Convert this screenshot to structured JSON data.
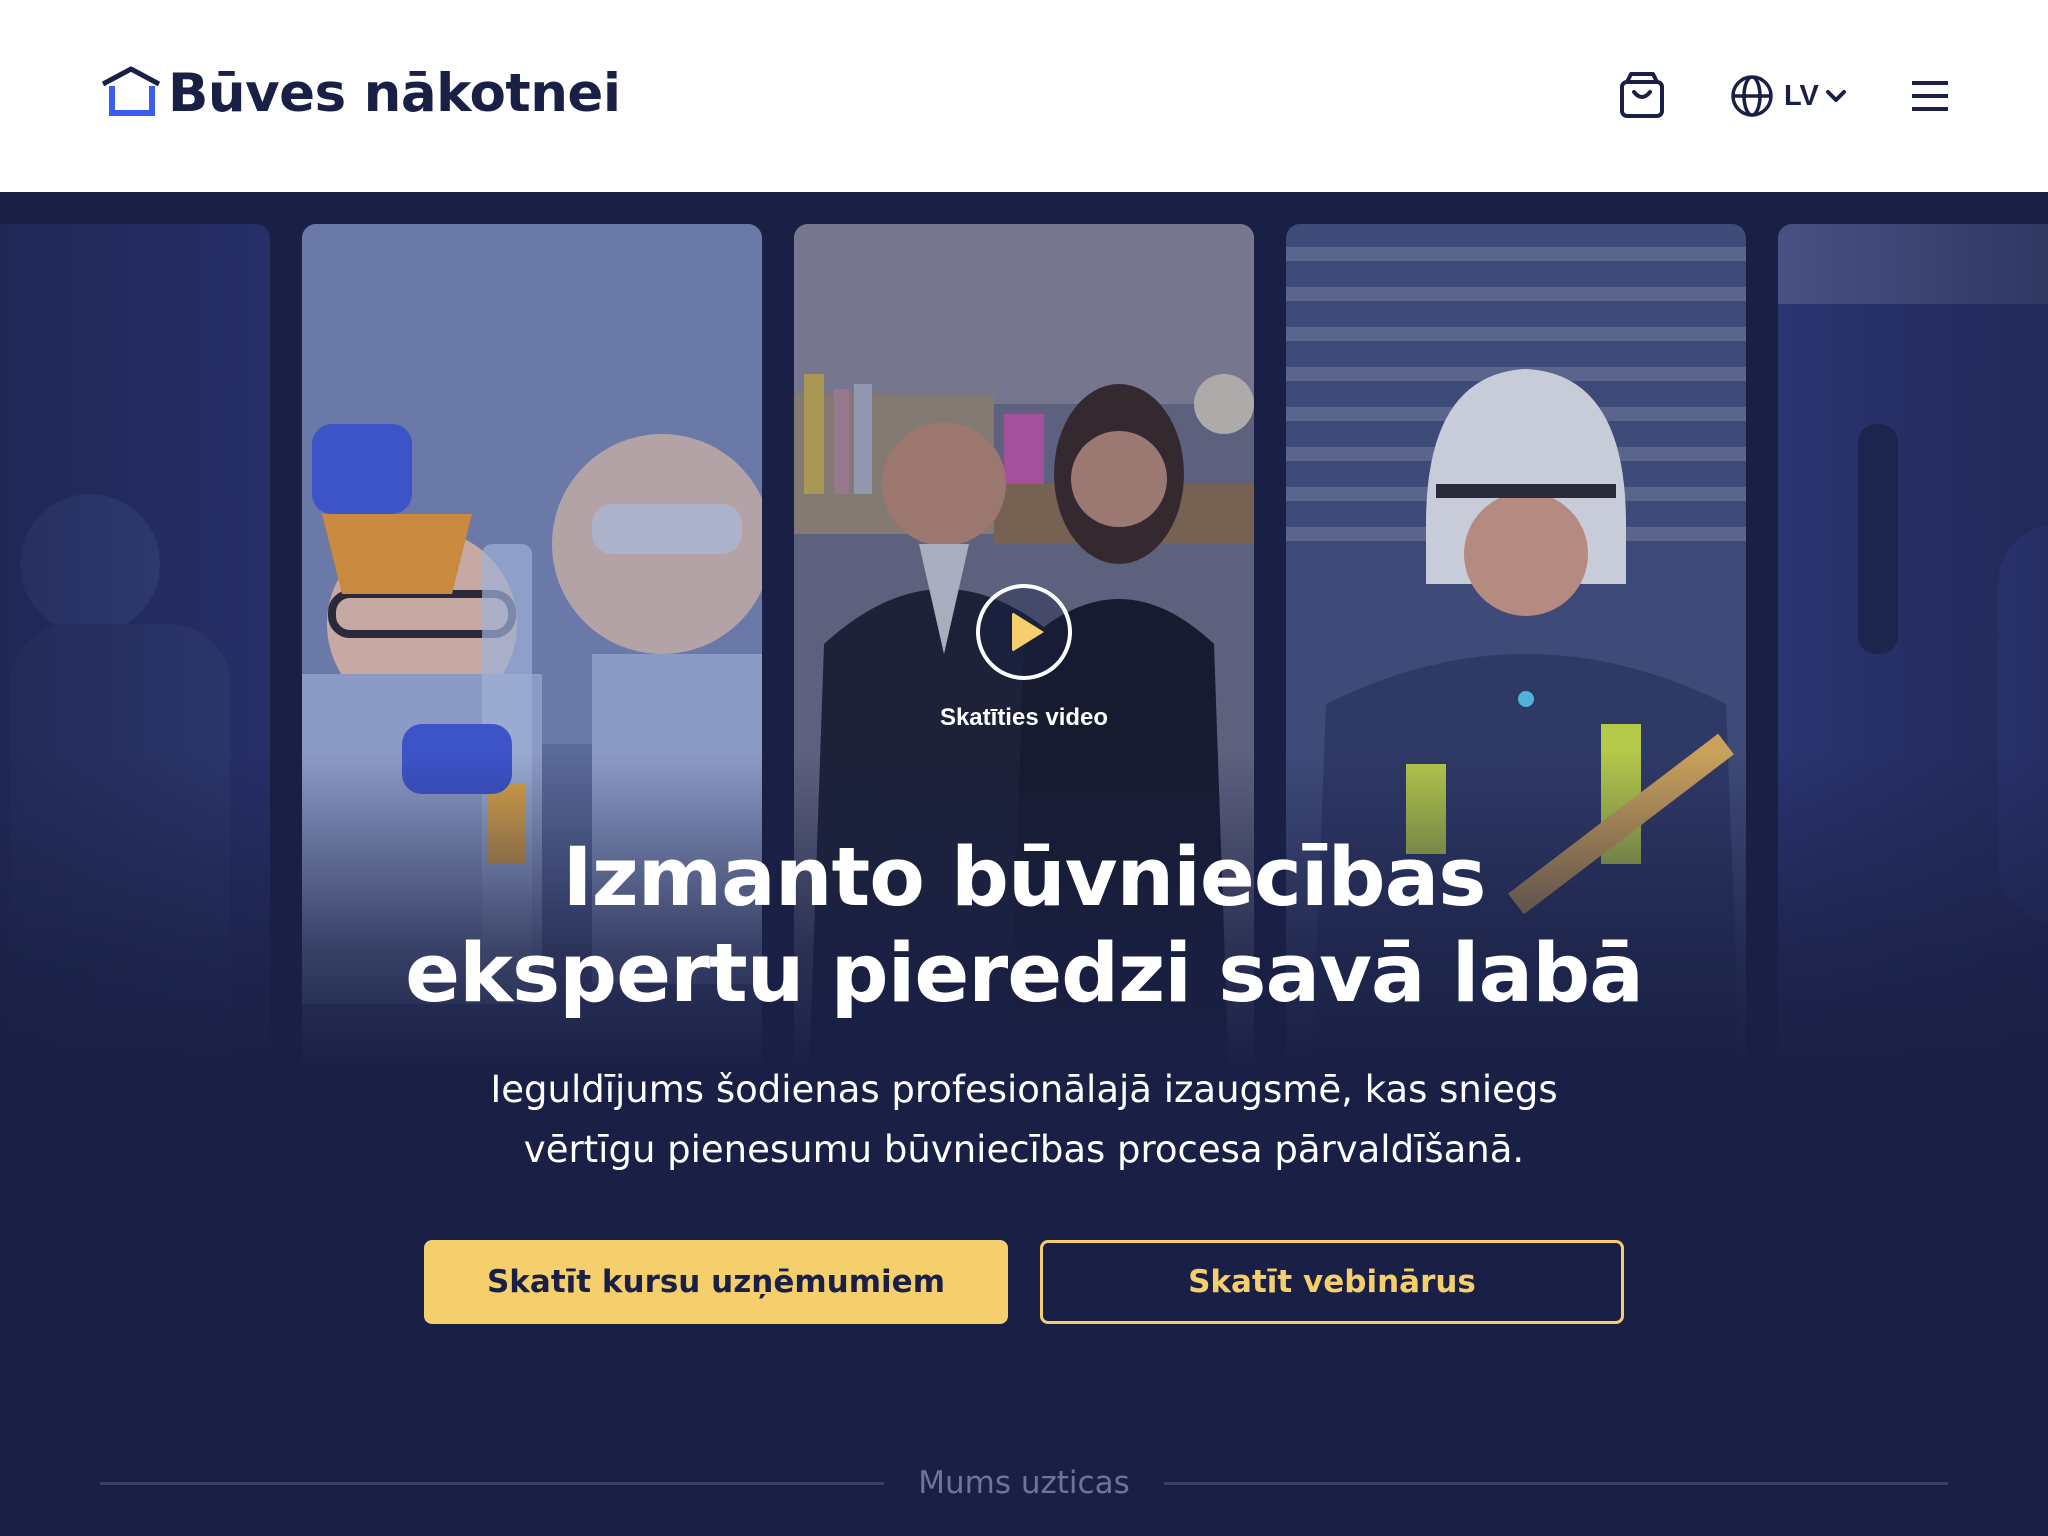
{
  "header": {
    "logo_text": "Būves nākotnei",
    "language": "LV"
  },
  "hero": {
    "video_label": "Skatīties video",
    "headline_line1": "Izmanto būvniecības",
    "headline_line2": "ekspertu pieredzi savā labā",
    "subtitle_line1": "Ieguldījums šodienas profesionālajā izaugsmē, kas sniegs",
    "subtitle_line2": "vērtīgu pienesumu būvniecības procesa pārvaldīšanā.",
    "primary_button": "Skatīt kursu uzņēmumiem",
    "secondary_button": "Skatīt vebinārus"
  },
  "trust": {
    "label": "Mums uzticas"
  },
  "colors": {
    "navy": "#1a2045",
    "accent_yellow": "#f4cf6c",
    "logo_blue": "#3a5cf0"
  },
  "icons": [
    "logo-house-icon",
    "cart-icon",
    "globe-icon",
    "chevron-down-icon",
    "menu-icon",
    "play-icon"
  ]
}
